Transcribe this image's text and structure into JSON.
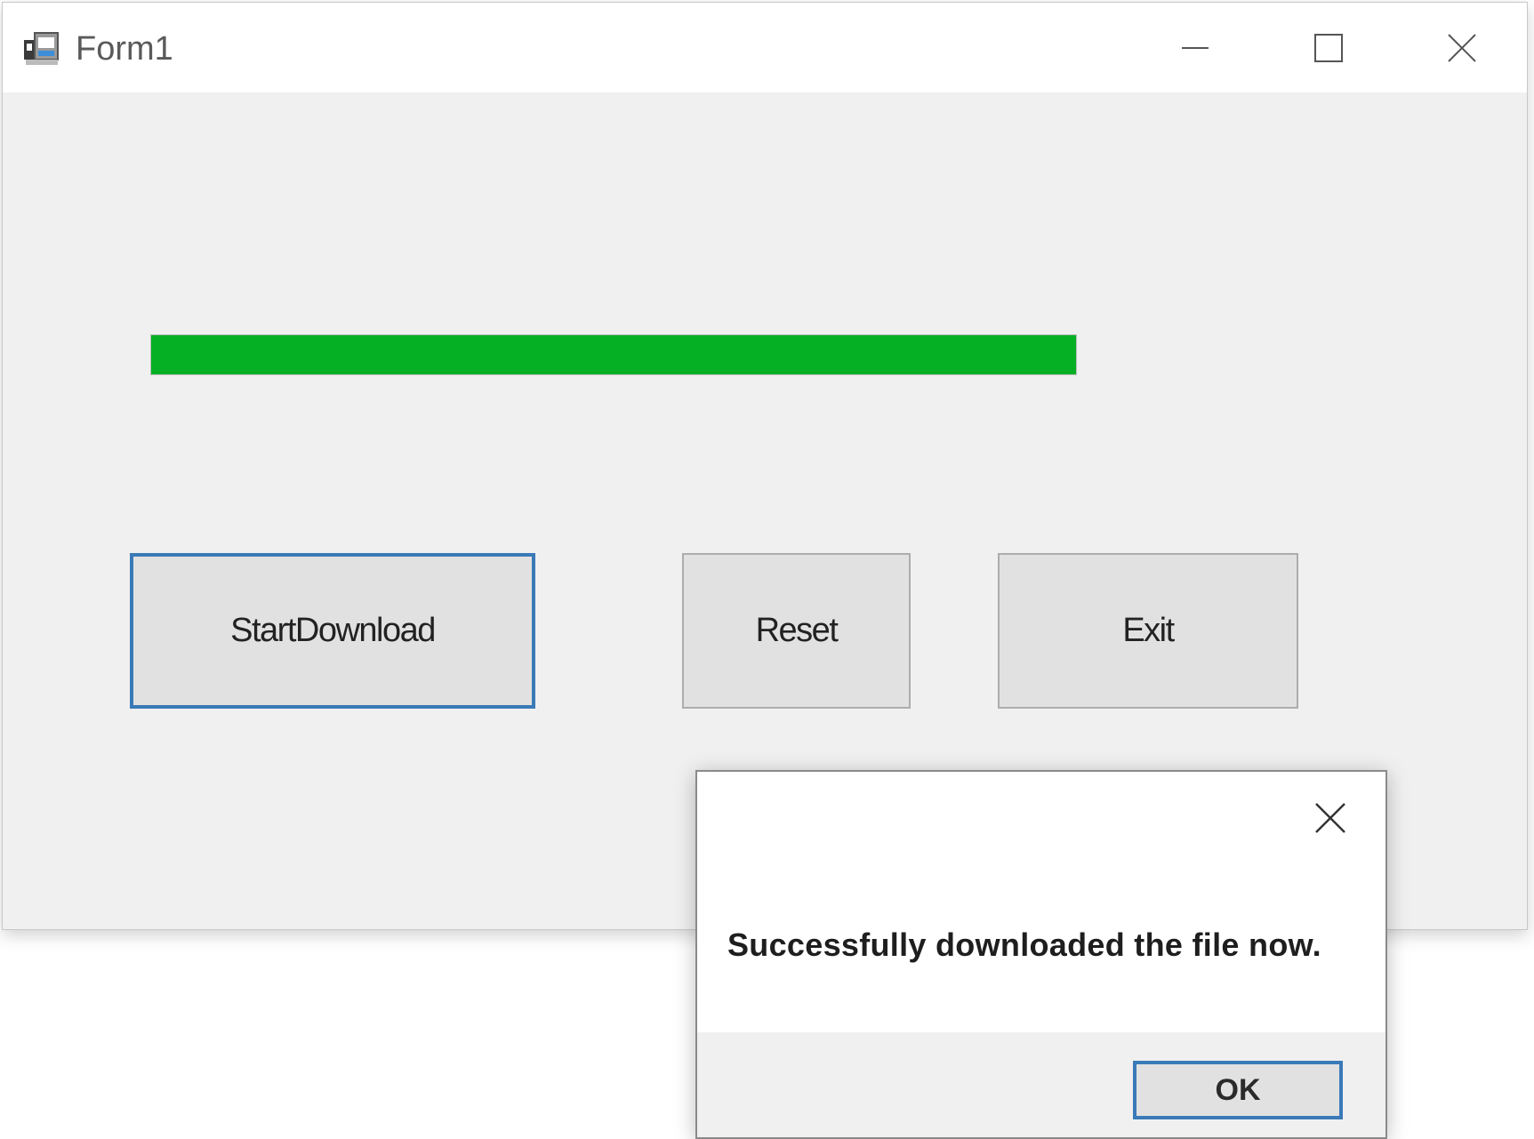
{
  "window": {
    "title": "Form1",
    "icon": "app-form-icon",
    "caption_buttons": [
      "minimize-icon",
      "maximize-icon",
      "close-icon"
    ]
  },
  "progress": {
    "value_percent": 100,
    "color": "#06b025"
  },
  "buttons": {
    "start_download": "StartDownload",
    "reset": "Reset",
    "exit": "Exit"
  },
  "dialog": {
    "message": "Successfully downloaded the file now.",
    "ok_label": "OK",
    "close_icon": "close-icon"
  },
  "colors": {
    "focus_border": "#3a7ab8",
    "form_background": "#f0f0f0",
    "button_face": "#e1e1e1"
  }
}
